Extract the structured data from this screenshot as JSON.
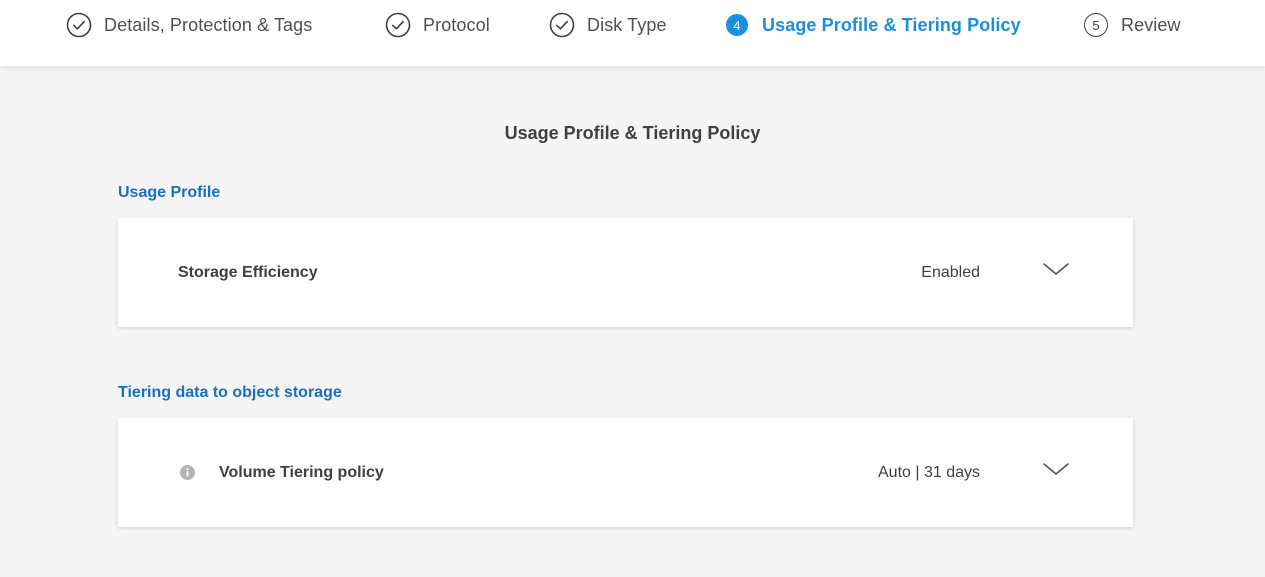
{
  "wizard": {
    "steps": [
      {
        "number": "1",
        "label": "Details, Protection & Tags",
        "status": "completed"
      },
      {
        "number": "2",
        "label": "Protocol",
        "status": "completed"
      },
      {
        "number": "3",
        "label": "Disk Type",
        "status": "completed"
      },
      {
        "number": "4",
        "label": "Usage Profile & Tiering Policy",
        "status": "active"
      },
      {
        "number": "5",
        "label": "Review",
        "status": "pending"
      }
    ]
  },
  "page": {
    "title": "Usage Profile & Tiering Policy"
  },
  "usage_profile": {
    "section_title": "Usage Profile",
    "storage_efficiency": {
      "label": "Storage Efficiency",
      "value": "Enabled"
    }
  },
  "tiering": {
    "section_title": "Tiering data to object storage",
    "volume_tiering_policy": {
      "label": "Volume Tiering policy",
      "value": "Auto | 31 days"
    }
  },
  "colors": {
    "accent": "#1a8fe0",
    "section_title": "#1a6fc2",
    "text": "#404040",
    "background": "#f5f5f5"
  },
  "icons": {
    "completed_step": "check-circle-icon",
    "expand": "chevron-down-icon",
    "info": "info-icon"
  }
}
